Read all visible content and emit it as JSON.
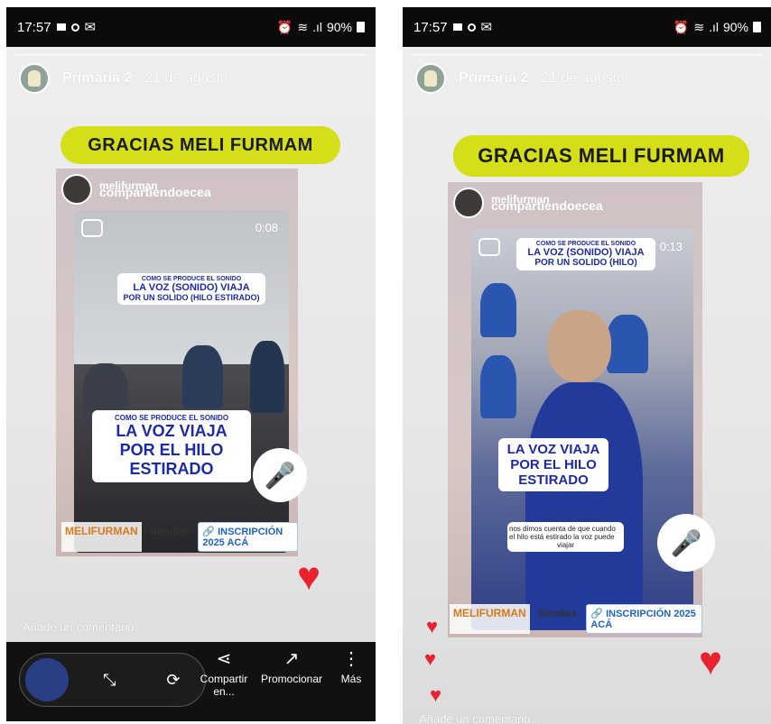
{
  "status_bar": {
    "time": "17:57",
    "battery": "90%",
    "signal": ".ıl"
  },
  "story": {
    "username": "Primaria 2",
    "date": "21 de agosto",
    "banner": "GRACIAS MELI FURMAM",
    "repost_user": "melifurman",
    "repost_account": "compartiendoecea",
    "comment_placeholder": "Añade un comentario..."
  },
  "left_video": {
    "time": "0:08",
    "caption_top": [
      "COMO SE PRODUCE EL SONIDO",
      "LA VOZ (SONIDO) VIAJA",
      "POR UN SOLIDO (HILO ESTIRADO)"
    ],
    "caption_main": [
      "COMO SE PRODUCE EL SONIDO",
      "LA VOZ VIAJA",
      "POR EL HILO",
      "ESTIRADO"
    ]
  },
  "right_video": {
    "time": "0:13",
    "caption_top": [
      "COMO SE PRODUCE EL SONIDO",
      "LA VOZ (SONIDO) VIAJA",
      "POR UN SOLIDO (HILO)"
    ],
    "caption_main": [
      "LA VOZ VIAJA",
      "POR EL HILO",
      "ESTIRADO"
    ],
    "subtitle": [
      "nos dimos cuenta de que cuando",
      "el hilo está estirado la voz puede",
      "viajar"
    ]
  },
  "labels": {
    "meli": "MELIFURMAN",
    "partial": "tiendoe",
    "inscripcion": "🔗 INSCRIPCIÓN 2025 ACÁ"
  },
  "action_bar": {
    "share": "Compartir en...",
    "promote": "Promocionar",
    "more": "Más"
  },
  "colors": {
    "banner": "#d4df1a",
    "heart": "#e8232f",
    "caption_text": "#1c2aa6"
  }
}
